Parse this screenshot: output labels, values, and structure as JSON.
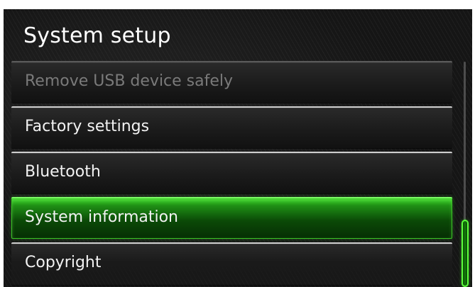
{
  "header": {
    "title": "System setup"
  },
  "menu": {
    "items": [
      {
        "label": "Remove USB device safely",
        "state": "disabled"
      },
      {
        "label": "Factory settings",
        "state": "normal"
      },
      {
        "label": "Bluetooth",
        "state": "normal"
      },
      {
        "label": "System information",
        "state": "selected"
      },
      {
        "label": "Copyright",
        "state": "normal"
      }
    ]
  },
  "scrollbar": {
    "thumb_start_fraction": 0.7,
    "thumb_extent_fraction": 0.3
  },
  "colors": {
    "background": "#151515",
    "text": "#f2f2f2",
    "text_disabled": "#7a7a7a",
    "accent_green": "#3ed82b",
    "separator": "#cfcfcf"
  }
}
